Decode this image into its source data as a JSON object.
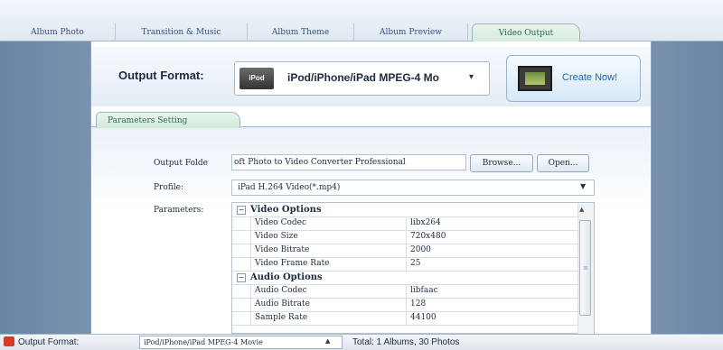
{
  "tabs": [
    {
      "label": "Album Photo"
    },
    {
      "label": "Transition & Music"
    },
    {
      "label": "Album Theme"
    },
    {
      "label": "Album Preview"
    },
    {
      "label": "Video Output"
    }
  ],
  "output_format": {
    "label": "Output Format:",
    "icon_text": "iPod",
    "selected": "iPod/iPhone/iPad MPEG-4 Mo",
    "create_button": "Create Now!"
  },
  "parameters_tab": "Parameters Setting",
  "folder": {
    "label": "Output Folde",
    "value": "oft Photo to Video Converter Professional",
    "browse": "Browse...",
    "open": "Open..."
  },
  "profile": {
    "label": "Profile:",
    "value": "iPad H.264 Video(*.mp4)"
  },
  "parameters": {
    "label": "Parameters:",
    "groups": [
      {
        "title": "Video Options",
        "rows": [
          {
            "key": "Video Codec",
            "value": "libx264"
          },
          {
            "key": "Video Size",
            "value": "720x480"
          },
          {
            "key": "Video Bitrate",
            "value": "2000"
          },
          {
            "key": "Video Frame Rate",
            "value": "25"
          }
        ]
      },
      {
        "title": "Audio Options",
        "rows": [
          {
            "key": "Audio Codec",
            "value": "libfaac"
          },
          {
            "key": "Audio Bitrate",
            "value": "128"
          },
          {
            "key": "Sample Rate",
            "value": "44100"
          }
        ]
      }
    ]
  },
  "statusbar": {
    "label": "Output Format:",
    "selected": "iPod/iPhone/iPad MPEG-4 Movie",
    "total": "Total: 1 Albums, 30 Photos"
  },
  "colors": {
    "accent": "#2a6a52",
    "link": "#1f64b0",
    "panel_bg": "#6d88a6"
  }
}
